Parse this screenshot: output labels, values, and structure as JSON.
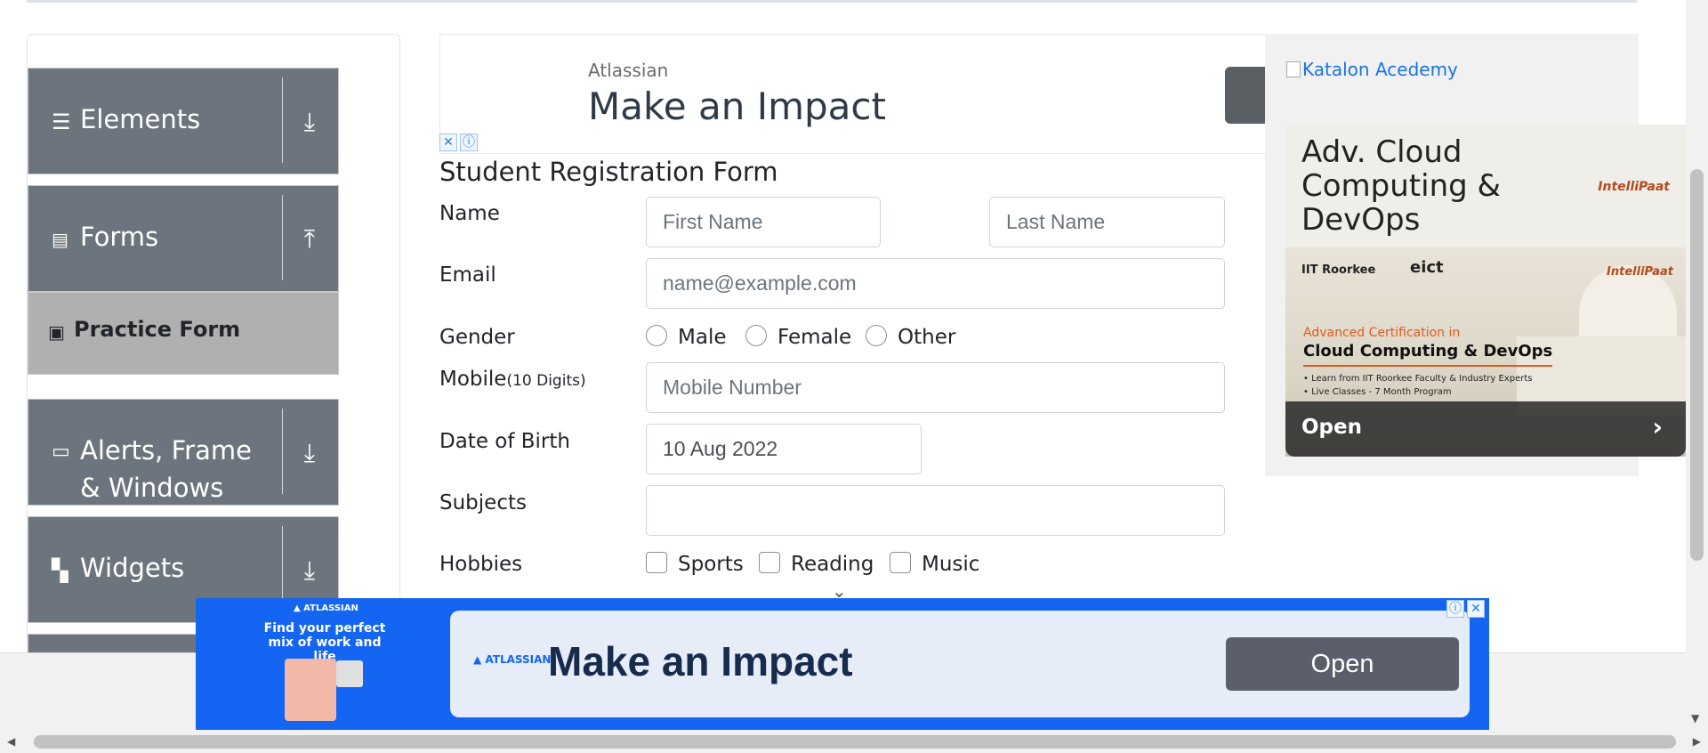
{
  "sidebar": {
    "groups": [
      {
        "label": "Elements",
        "icon": "hamburger-icon",
        "arrow": "⤓"
      },
      {
        "label": "Forms",
        "icon": "document-icon",
        "arrow": "⤒"
      },
      {
        "label": "Alerts, Frame & Windows",
        "icon": "window-icon",
        "arrow": "⤓"
      },
      {
        "label": "Widgets",
        "icon": "widgets-icon",
        "arrow": "⤓"
      }
    ],
    "active_item": "Practice Form"
  },
  "top_ad": {
    "brand": "Atlassian",
    "headline": "Make an Impact"
  },
  "form": {
    "title": "Student Registration Form",
    "name_label": "Name",
    "first_name_placeholder": "First Name",
    "last_name_placeholder": "Last Name",
    "email_label": "Email",
    "email_placeholder": "name@example.com",
    "gender_label": "Gender",
    "gender_options": [
      "Male",
      "Female",
      "Other"
    ],
    "mobile_label": "Mobile",
    "mobile_hint": "(10 Digits)",
    "mobile_placeholder": "Mobile Number",
    "dob_label": "Date of Birth",
    "dob_value": "10 Aug 2022",
    "subjects_label": "Subjects",
    "hobbies_label": "Hobbies",
    "hobby_options": [
      "Sports",
      "Reading",
      "Music"
    ]
  },
  "right_ad": {
    "katalon_alt": "Katalon Acedemy",
    "title": "Adv. Cloud Computing & DevOps",
    "brand": "IntelliPaat",
    "iit": "IIT Roorkee",
    "eict": "eict",
    "advanced": "Advanced Certification in",
    "course": "Cloud Computing & DevOps",
    "bullet1": "• Learn from IIT Roorkee Faculty & Industry Experts",
    "bullet2": "• Live Classes - 7 Month Program",
    "open_label": "Open",
    "open_arrow": "›"
  },
  "bottom_ad": {
    "brand": "▲ ATLASSIAN",
    "tagline": "Find your perfect mix of work and life",
    "logo": "▲ ATLASSIAN",
    "headline": "Make an Impact",
    "open_label": "Open"
  },
  "ad_controls": {
    "close": "✕",
    "info": "ⓘ"
  },
  "colors": {
    "sidebar_group": "#6c757d",
    "active_item": "#b0b0b0",
    "ad_blue": "#1466f2"
  }
}
